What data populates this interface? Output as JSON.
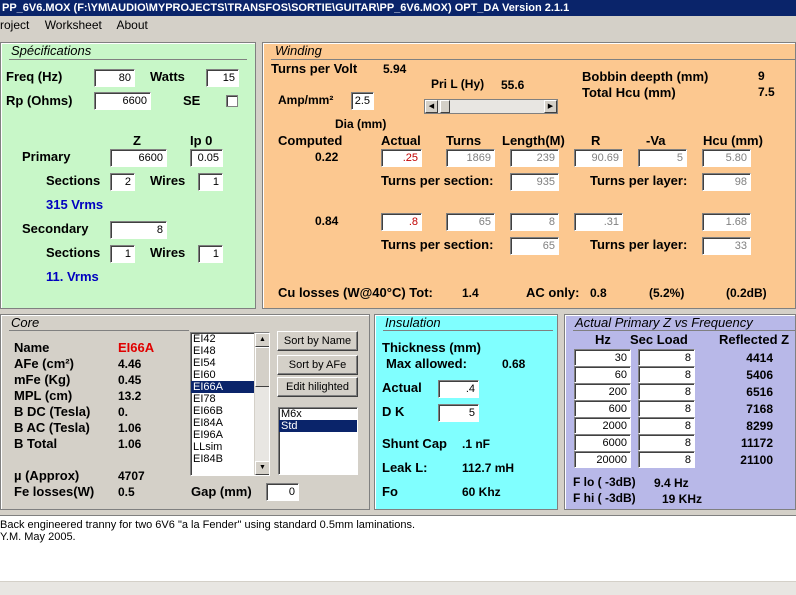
{
  "window": {
    "title": "PP_6V6.MOX  (F:\\YM\\AUDIO\\MYPROJECTS\\TRANSFOS\\SORTIE\\GUITAR\\PP_6V6.MOX)  OPT_DA Version 2.1.1",
    "menu": [
      "roject",
      "Worksheet",
      "About"
    ]
  },
  "colors": {
    "spec_bg": "#c8f7c8",
    "winding_bg": "#fcc890",
    "core_bg": "#d4d0c8",
    "insul_bg": "#80ffff",
    "freq_bg": "#b8b8e8",
    "title_bar": "#0a246a"
  },
  "spec": {
    "title": "Spécifications",
    "freq_label": "Freq (Hz)",
    "freq": "80",
    "watts_label": "Watts",
    "watts": "15",
    "rp_label": "Rp (Ohms)",
    "rp": "6600",
    "se_label": "SE",
    "z_label": "Z",
    "ip0_label": "Ip 0",
    "primary_label": "Primary",
    "primary_z": "6600",
    "primary_ip0": "0.05",
    "sections_label": "Sections",
    "wires_label": "Wires",
    "primary_sections": "2",
    "primary_wires": "1",
    "primary_vrms": "315 Vrms",
    "secondary_label": "Secondary",
    "secondary_z": "8",
    "secondary_sections": "1",
    "secondary_wires": "1",
    "secondary_vrms": "11. Vrms"
  },
  "winding": {
    "title": "Winding",
    "tpv_label": "Turns per Volt",
    "tpv": "5.94",
    "pril_label": "Pri L (Hy)",
    "pril": "55.6",
    "bobbin_label": "Bobbin deepth (mm)",
    "bobbin": "9",
    "hcu_total_label": "Total Hcu (mm)",
    "hcu_total": "7.5",
    "amp_label": "Amp/mm²",
    "amp": "2.5",
    "slider_level": 0.02,
    "dia_label": "Dia (mm)",
    "computed_label": "Computed",
    "actual_label": "Actual",
    "turns_label": "Turns",
    "length_label": "Length(M)",
    "r_label": "R",
    "va_label": "-Va",
    "hcu_label": "Hcu (mm)",
    "p_computed": "0.22",
    "p_actual": ".25",
    "p_turns": "1869",
    "p_length": "239",
    "p_r": "90.69",
    "p_va": "5",
    "p_hcu": "5.80",
    "tps_label": "Turns per section:",
    "tpl_label": "Turns per layer:",
    "p_tps": "935",
    "p_tpl": "98",
    "s_computed": "0.84",
    "s_actual": ".8",
    "s_turns": "65",
    "s_length": "8",
    "s_r": ".31",
    "s_hcu": "1.68",
    "s_tps": "65",
    "s_tpl": "33",
    "culoss_label": "Cu losses (W@40°C) Tot:",
    "culoss": "1.4",
    "aconly_label": "AC only:",
    "aconly": "0.8",
    "aconly_pct": "(5.2%)",
    "aconly_db": "(0.2dB)"
  },
  "core": {
    "title": "Core",
    "name_label": "Name",
    "name": "EI66A",
    "afe_label": "AFe (cm²)",
    "afe": "4.46",
    "mfe_label": "mFe (Kg)",
    "mfe": "0.45",
    "mpl_label": "MPL (cm)",
    "mpl": "13.2",
    "bdc_label": "B DC (Tesla)",
    "bdc": "0.",
    "bac_label": "B AC (Tesla)",
    "bac": "1.06",
    "btot_label": "B Total",
    "btot": "1.06",
    "mu_label": "µ (Approx)",
    "mu": "4707",
    "feloss_label": "Fe losses(W)",
    "feloss": "0.5",
    "gap_label": "Gap (mm)",
    "gap": "0",
    "cores": [
      "EI42",
      "EI48",
      "EI54",
      "EI60",
      "EI66A",
      "EI78",
      "EI66B",
      "EI84A",
      "EI96A",
      "LLsim",
      "EI84B"
    ],
    "selected_core": "EI66A",
    "btn_sort_name": "Sort by Name",
    "btn_sort_afe": "Sort by AFe",
    "btn_edit": "Edit hilighted",
    "grades": [
      "M6x",
      "Std"
    ],
    "selected_grade": "Std"
  },
  "insulation": {
    "title": "Insulation",
    "thick_label": "Thickness (mm)",
    "max_label": "Max allowed:",
    "max": "0.68",
    "actual_label": "Actual",
    "actual": ".4",
    "dk_label": "D K",
    "dk": "5",
    "shunt_label": "Shunt Cap",
    "shunt": ".1 nF",
    "leak_label": "Leak L:",
    "leak": "112.7 mH",
    "fo_label": "Fo",
    "fo": "60 Khz"
  },
  "freq": {
    "title": "Actual Primary Z vs Frequency",
    "hz_label": "Hz",
    "load_label": "Sec Load",
    "refl_label": "Reflected Z",
    "rows": [
      {
        "hz": "30",
        "load": "8",
        "z": "4414"
      },
      {
        "hz": "60",
        "load": "8",
        "z": "5406"
      },
      {
        "hz": "200",
        "load": "8",
        "z": "6516"
      },
      {
        "hz": "600",
        "load": "8",
        "z": "7168"
      },
      {
        "hz": "2000",
        "load": "8",
        "z": "8299"
      },
      {
        "hz": "6000",
        "load": "8",
        "z": "11172"
      },
      {
        "hz": "20000",
        "load": "8",
        "z": "21100"
      }
    ],
    "flo_label": "F lo ( -3dB)",
    "flo": "9.4 Hz",
    "fhi_label": "F hi ( -3dB)",
    "fhi": "19 KHz"
  },
  "notes": {
    "line1": "Back engineered tranny for two 6V6 \"a la Fender\" using standard 0.5mm laminations.",
    "line2": "Y.M. May 2005."
  }
}
